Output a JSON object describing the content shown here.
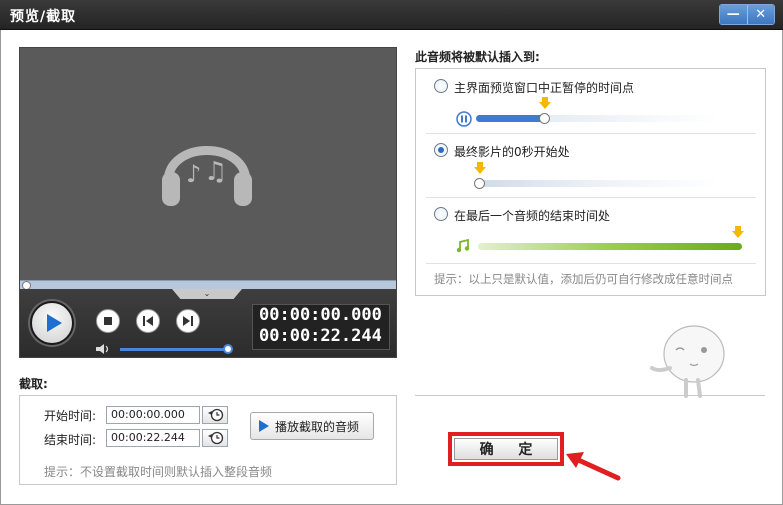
{
  "window": {
    "title": "预览/截取",
    "minimize": "—",
    "close": "✕"
  },
  "player": {
    "time_current": "00:00:00.000",
    "time_total": "00:00:22.244",
    "playback_position": 0.0,
    "volume_level": 0.95,
    "icons": [
      "headphone-music-icon",
      "play-icon",
      "stop-icon",
      "prev-frame-icon",
      "next-frame-icon",
      "volume-icon"
    ]
  },
  "capture": {
    "label": "截取:",
    "start_label": "开始时间:",
    "start_value": "00:00:00.000",
    "end_label": "结束时间:",
    "end_value": "00:00:22.244",
    "play_button": "播放截取的音频",
    "hint": "提示：不设置截取时间则默认插入整段音频"
  },
  "insert": {
    "title": "此音频将被默认插入到:",
    "options": [
      {
        "label": "主界面预览窗口中正暂停的时间点",
        "selected": false,
        "position": 0.28
      },
      {
        "label": "最终影片的0秒开始处",
        "selected": true,
        "position": 0.0
      },
      {
        "label": "在最后一个音频的结束时间处",
        "selected": false,
        "position": 1.0
      }
    ],
    "hint": "提示：以上只是默认值，添加后仍可自行修改成任意时间点"
  },
  "ok_button": "确 定",
  "colors": {
    "accent": "#3d7bd0",
    "highlight": "#e02020",
    "green": "#7ab829",
    "marker": "#f5b800"
  }
}
